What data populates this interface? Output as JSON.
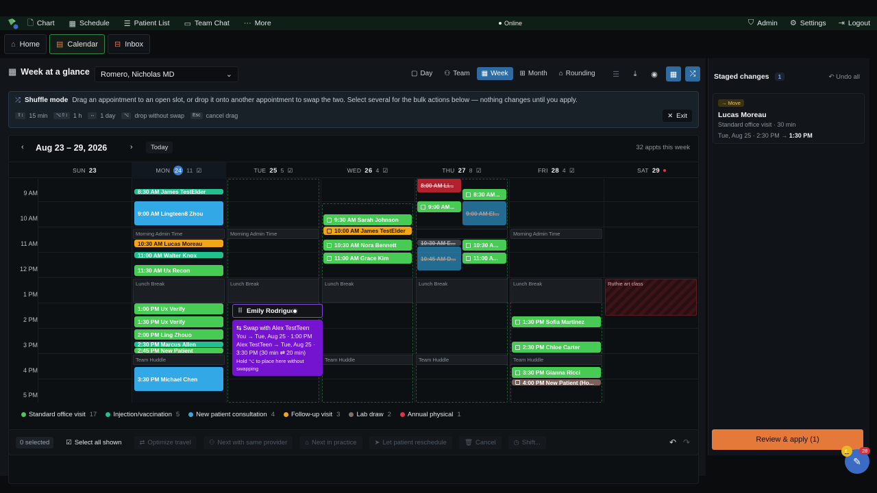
{
  "nav": {
    "items": [
      {
        "label": "Chart",
        "icon": "doc-icon"
      },
      {
        "label": "Schedule",
        "icon": "calendar-icon"
      },
      {
        "label": "Patient List",
        "icon": "list-icon"
      },
      {
        "label": "Team Chat",
        "icon": "chat-icon"
      },
      {
        "label": "More",
        "icon": "dots-icon"
      }
    ],
    "status": "Online",
    "admin": "Admin",
    "settings": "Settings",
    "logout": "Logout"
  },
  "tabs": [
    {
      "label": "Home"
    },
    {
      "label": "Calendar"
    },
    {
      "label": "Inbox"
    }
  ],
  "header": {
    "title": "Week at a glance",
    "provider": "Romero, Nicholas MD",
    "views": [
      "Day",
      "Team",
      "Week",
      "Month",
      "Rounding"
    ],
    "active_view": "Week"
  },
  "shuffle": {
    "title": "Shuffle mode",
    "text": "Drag an appointment to an open slot, or drop it onto another appointment to swap the two. Select several for the bulk actions below — nothing changes until you apply.",
    "hints": [
      {
        "key": "⇧↕",
        "label": "15 min"
      },
      {
        "key": "⌥⇧↕",
        "label": "1 h"
      },
      {
        "key": "↔",
        "label": "1 day"
      },
      {
        "key": "⌥",
        "label": "drop without swap"
      },
      {
        "key": "Esc",
        "label": "cancel drag"
      }
    ],
    "exit": "Exit"
  },
  "calendar": {
    "range": "Aug 23 – 29, 2026",
    "today": "Today",
    "count": "32 appts this week",
    "days": [
      {
        "dow": "SUN",
        "num": "23",
        "count": ""
      },
      {
        "dow": "MON",
        "num": "24",
        "count": "11"
      },
      {
        "dow": "TUE",
        "num": "25",
        "count": "5"
      },
      {
        "dow": "WED",
        "num": "26",
        "count": "4"
      },
      {
        "dow": "THU",
        "num": "27",
        "count": "8"
      },
      {
        "dow": "FRI",
        "num": "28",
        "count": "4"
      },
      {
        "dow": "SAT",
        "num": "29",
        "count": ""
      }
    ],
    "hours": [
      "9 AM",
      "10 AM",
      "11 AM",
      "12 PM",
      "1 PM",
      "2 PM",
      "3 PM",
      "4 PM",
      "5 PM"
    ],
    "blocks": {
      "morning": "Morning Admin Time",
      "lunch": "Lunch Break",
      "huddle": "Team Huddle",
      "ruthie": "Ruthie art class"
    },
    "appointments": {
      "mon": [
        "8:30 AM James TestElder",
        "9:00 AM Lingteen8 Zhou",
        "10:30 AM Lucas Moreau",
        "11:00 AM Walter Knox",
        "11:30 AM Ux Recon",
        "1:00 PM Ux Verify",
        "1:30 PM Ux Verify",
        "2:00 PM Ling Zhouo",
        "2:30 PM Marcus Allen",
        "2:45 PM New Patient",
        "3:30 PM Michael Chen"
      ],
      "wed": [
        "9:30 AM Sarah Johnson",
        "10:00 AM James TestElder",
        "10:30 AM Nora Bennett",
        "11:00 AM Grace Kim"
      ],
      "thu": [
        "8:00 AM Li...",
        "8:30 AM...",
        "9:00 AM...",
        "9:00 AM El...",
        "10:30 AM E...",
        "10:30 A...",
        "10:45 AM D...",
        "11:00 A..."
      ],
      "fri": [
        "1:30 PM Sofia Martinez",
        "2:30 PM Chloe Carter",
        "3:30 PM Gianna Ricci",
        "4:00 PM New Patient (Ho..."
      ]
    },
    "drag_label": "Emily Rodrigue",
    "popup": {
      "title": "Swap with Alex TestTeen",
      "line1": "You → Tue, Aug 25 · 1:00 PM",
      "line2": "Alex TestTeen → Tue, Aug 25 · 3:30 PM (30 min ⇄ 20 min)",
      "hint": "Hold ⌥ to place here without swapping"
    }
  },
  "legend": [
    {
      "label": "Standard office visit",
      "n": "17",
      "color": "#48cb55"
    },
    {
      "label": "Injection/vaccination",
      "n": "5",
      "color": "#23c08f"
    },
    {
      "label": "New patient consultation",
      "n": "4",
      "color": "#33a8e6"
    },
    {
      "label": "Follow-up visit",
      "n": "3",
      "color": "#f2a516"
    },
    {
      "label": "Lab draw",
      "n": "2",
      "color": "#8a6e66"
    },
    {
      "label": "Annual physical",
      "n": "1",
      "color": "#e0334a"
    }
  ],
  "bulk": {
    "selected": "0 selected",
    "select_all": "Select all shown",
    "actions": [
      "Optimize travel",
      "Next with same provider",
      "Next in practice",
      "Let patient reschedule",
      "Cancel",
      "Shift..."
    ]
  },
  "staged": {
    "title": "Staged changes",
    "count": "1",
    "undo": "Undo all",
    "tag": "→ Move",
    "name": "Lucas Moreau",
    "detail": "Standard office visit · 30 min",
    "from": "Tue, Aug 25 · 2:30 PM",
    "arrow": "→",
    "to": "1:30 PM",
    "review": "Review & apply (1)"
  },
  "fab": {
    "badge": "28"
  }
}
